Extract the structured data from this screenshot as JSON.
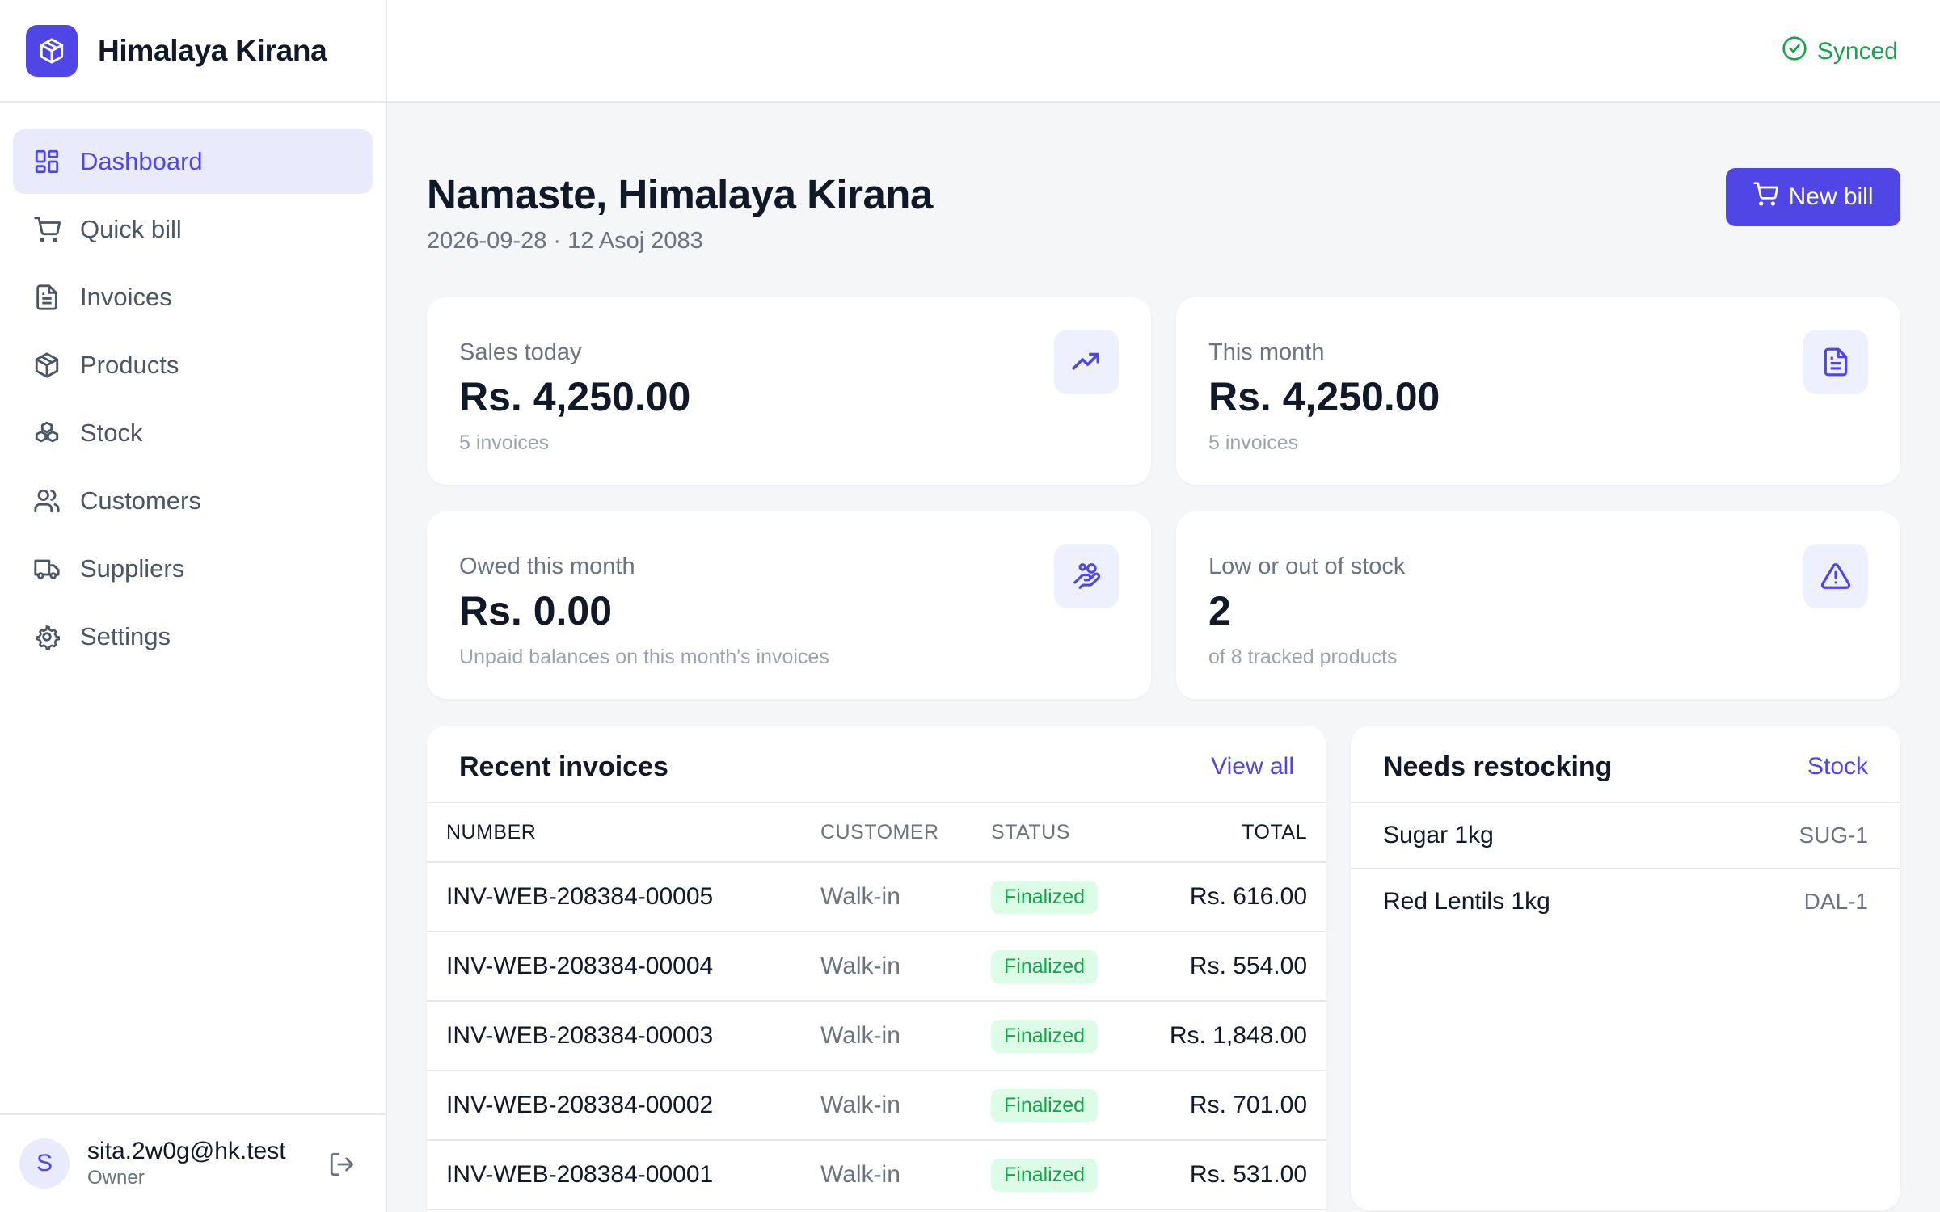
{
  "brand": {
    "name": "Himalaya Kirana",
    "logo_icon": "package-icon"
  },
  "sidebar": {
    "items": [
      {
        "label": "Dashboard",
        "icon": "dashboard-grid-icon",
        "active": true
      },
      {
        "label": "Quick bill",
        "icon": "cart-icon"
      },
      {
        "label": "Invoices",
        "icon": "file-icon"
      },
      {
        "label": "Products",
        "icon": "package-icon"
      },
      {
        "label": "Stock",
        "icon": "boxes-icon"
      },
      {
        "label": "Customers",
        "icon": "users-icon"
      },
      {
        "label": "Suppliers",
        "icon": "truck-icon"
      },
      {
        "label": "Settings",
        "icon": "gear-icon"
      }
    ]
  },
  "user": {
    "initial": "S",
    "email": "sita.2w0g@hk.test",
    "role": "Owner"
  },
  "topbar": {
    "sync_status": "Synced"
  },
  "header": {
    "greeting": "Namaste, Himalaya Kirana",
    "date": "2026-09-28 · 12 Asoj 2083",
    "new_bill_label": "New bill"
  },
  "stats": {
    "sales_today": {
      "label": "Sales today",
      "value": "Rs. 4,250.00",
      "sub": "5 invoices",
      "icon": "trending-up-icon"
    },
    "this_month": {
      "label": "This month",
      "value": "Rs. 4,250.00",
      "sub": "5 invoices",
      "icon": "file-icon"
    },
    "owed": {
      "label": "Owed this month",
      "value": "Rs. 0.00",
      "sub": "Unpaid balances on this month's invoices",
      "icon": "hand-coins-icon"
    },
    "low_stock": {
      "label": "Low or out of stock",
      "value": "2",
      "sub": "of 8 tracked products",
      "icon": "alert-triangle-icon"
    }
  },
  "recent_invoices": {
    "title": "Recent invoices",
    "view_all": "View all",
    "columns": [
      "NUMBER",
      "CUSTOMER",
      "STATUS",
      "TOTAL"
    ],
    "rows": [
      {
        "number": "INV-WEB-208384-00005",
        "customer": "Walk-in",
        "status": "Finalized",
        "total": "Rs. 616.00"
      },
      {
        "number": "INV-WEB-208384-00004",
        "customer": "Walk-in",
        "status": "Finalized",
        "total": "Rs. 554.00"
      },
      {
        "number": "INV-WEB-208384-00003",
        "customer": "Walk-in",
        "status": "Finalized",
        "total": "Rs. 1,848.00"
      },
      {
        "number": "INV-WEB-208384-00002",
        "customer": "Walk-in",
        "status": "Finalized",
        "total": "Rs. 701.00"
      },
      {
        "number": "INV-WEB-208384-00001",
        "customer": "Walk-in",
        "status": "Finalized",
        "total": "Rs. 531.00"
      }
    ]
  },
  "restock": {
    "title": "Needs restocking",
    "link": "Stock",
    "items": [
      {
        "name": "Sugar 1kg",
        "sku": "SUG-1"
      },
      {
        "name": "Red Lentils 1kg",
        "sku": "DAL-1"
      }
    ]
  },
  "colors": {
    "accent": "#4f46e5",
    "accent_soft": "#e9eafb",
    "success": "#16a34a",
    "success_soft": "#dcfce7"
  }
}
